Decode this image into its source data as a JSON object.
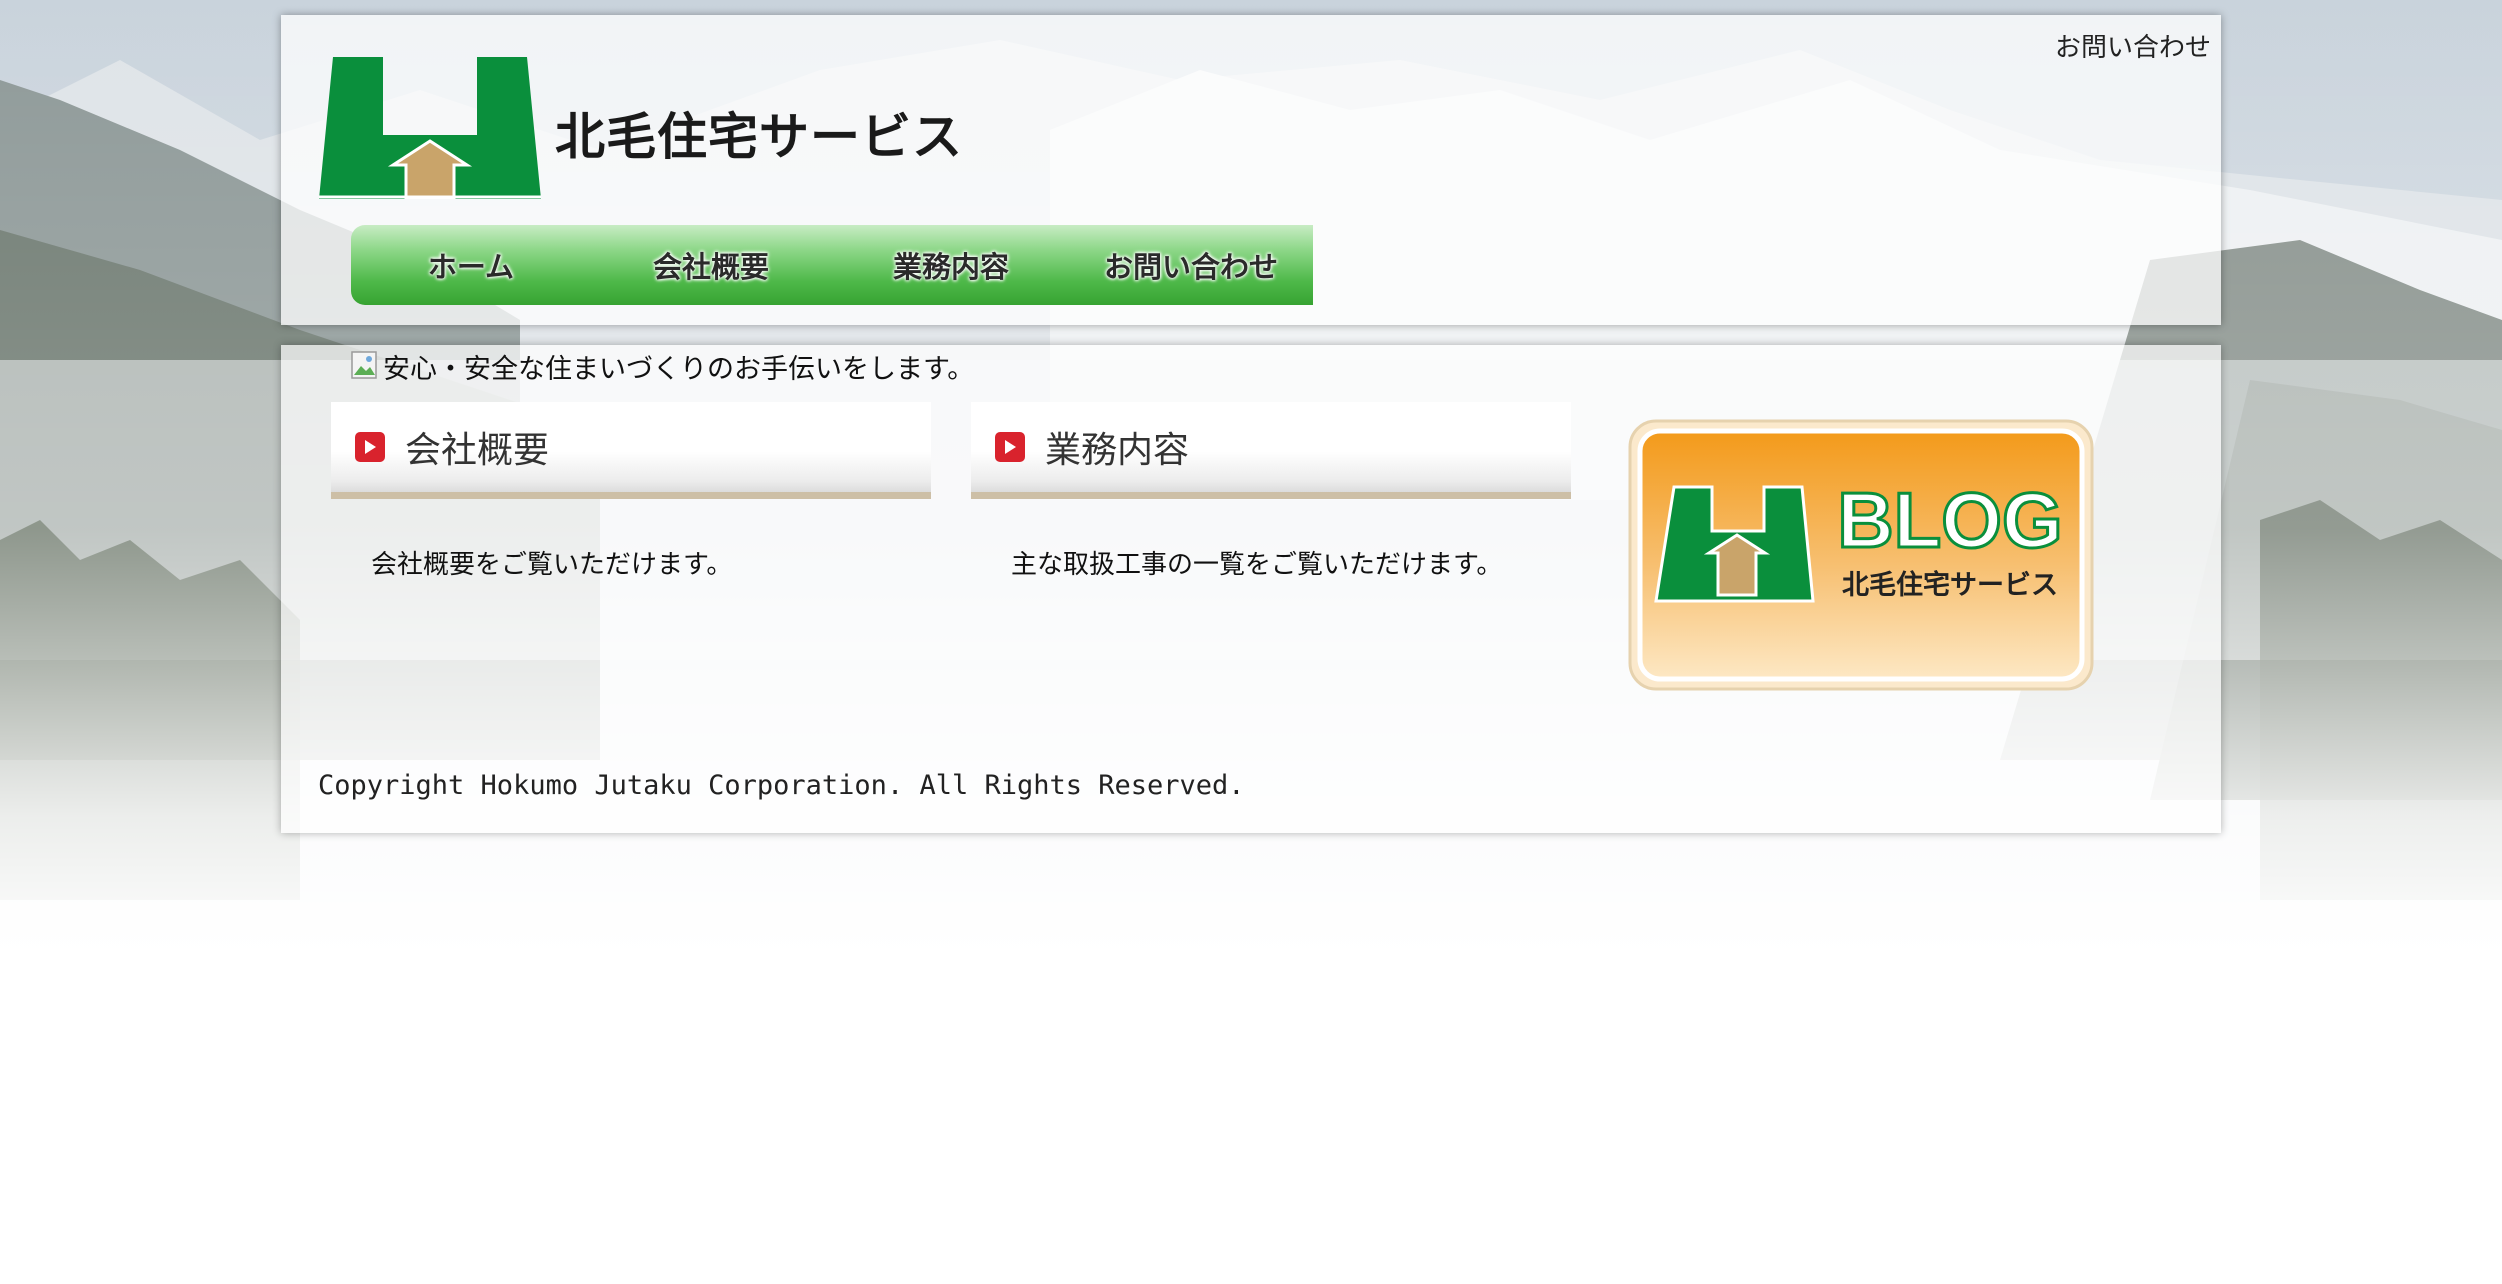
{
  "header": {
    "top_link": "お問い合わせ",
    "site_name": "北毛住宅サービス"
  },
  "nav": {
    "items": [
      {
        "label": "ホーム"
      },
      {
        "label": "会社概要"
      },
      {
        "label": "業務内容"
      },
      {
        "label": "お問い合わせ"
      }
    ]
  },
  "main": {
    "tagline": "安心・安全な住まいづくりのお手伝いをします。",
    "sections": [
      {
        "title": "会社概要",
        "description": "会社概要をご覧いただけます。"
      },
      {
        "title": "業務内容",
        "description": "主な取扱工事の一覧をご覧いただけます。"
      }
    ],
    "blog": {
      "label": "BLOG",
      "company": "北毛住宅サービス"
    }
  },
  "footer": {
    "copyright": "Copyright Hokumo Jutaku Corporation. All Rights Reserved."
  },
  "colors": {
    "brand_green": "#0a8f3c",
    "nav_green": "#4fb94a",
    "house_tan": "#c9a46a",
    "blog_orange": "#f39a1a",
    "section_icon_red": "#d9232d"
  }
}
